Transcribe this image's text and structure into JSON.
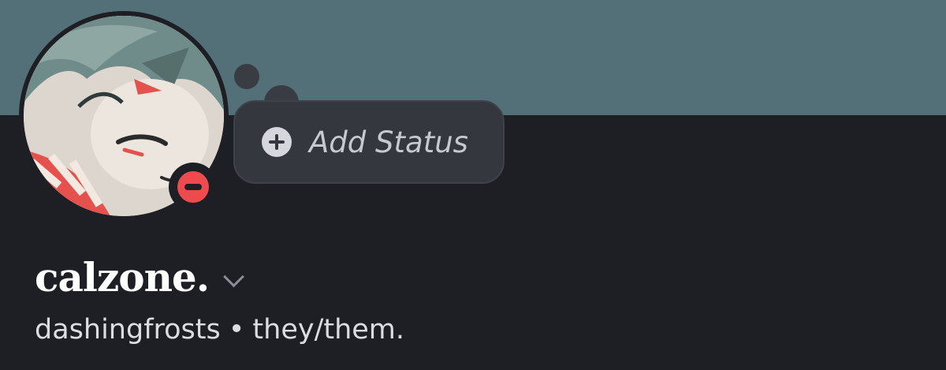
{
  "profile": {
    "display_name": "calzone.",
    "username": "dashingfrosts",
    "separator": "•",
    "pronouns": "they/them."
  },
  "status_bubble": {
    "label": "Add Status",
    "icon": "plus-circle-icon"
  },
  "presence": {
    "state_icon": "do-not-disturb-icon",
    "color": "#ef4b4f"
  },
  "colors": {
    "banner": "#537078",
    "background": "#1e1f24",
    "pill": "#35373e"
  }
}
